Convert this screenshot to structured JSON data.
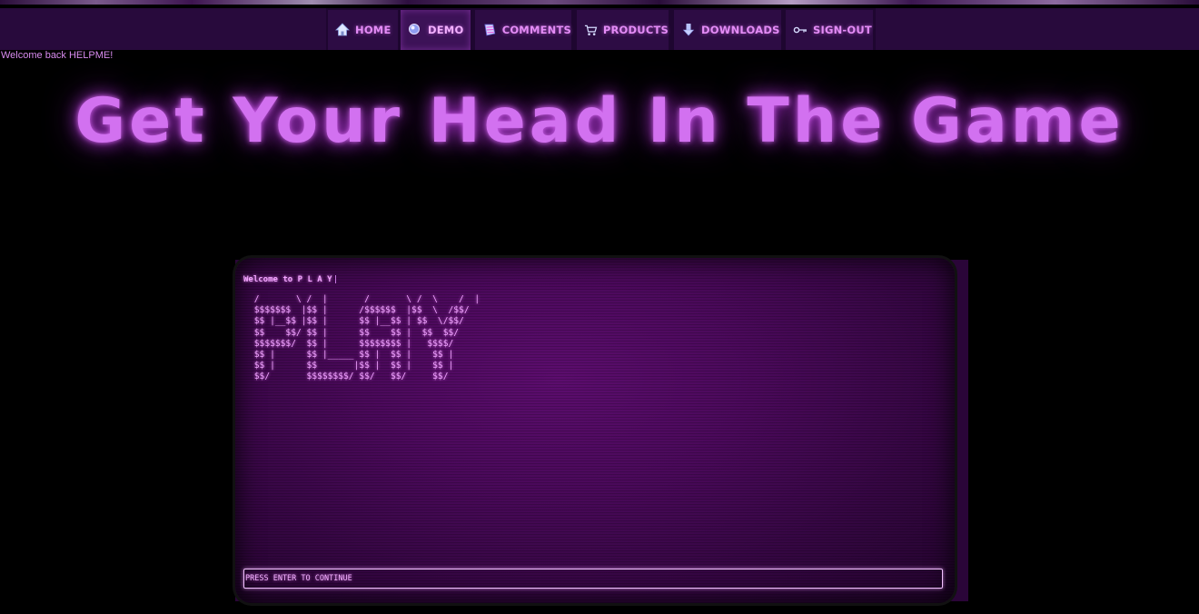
{
  "nav": {
    "items": [
      {
        "label": "HOME",
        "icon": "home-icon"
      },
      {
        "label": "DEMO",
        "icon": "demo-icon"
      },
      {
        "label": "COMMENTS",
        "icon": "comments-icon"
      },
      {
        "label": "PRODUCTS",
        "icon": "cart-icon"
      },
      {
        "label": "DOWNLOADS",
        "icon": "download-icon"
      },
      {
        "label": "SIGN-OUT",
        "icon": "key-icon"
      }
    ],
    "active": "DEMO"
  },
  "welcome": "Welcome back HELPME!",
  "headline": "Get Your Head In The Game",
  "terminal": {
    "title": "Welcome to P L A Y",
    "ascii_art": " /       \\ /  |       /       \\ /  \\    /  |\n $$$$$$$  |$$ |      /$$$$$$  |$$  \\  /$$/\n $$ |__$$ |$$ |      $$ |__$$ | $$  \\/$$/\n $$    $$/ $$ |      $$    $$ |  $$  $$/\n $$$$$$$/  $$ |      $$$$$$$$ |   $$$$/\n $$ |      $$ |_____ $$ |  $$ |    $$ |\n $$ |      $$       |$$ |  $$ |    $$ |\n $$/       $$$$$$$$/ $$/   $$/     $$/",
    "prompt": "PRESS ENTER TO CONTINUE"
  },
  "colors": {
    "accent": "#d271f0",
    "nav_bg": "#280a3c",
    "terminal_bg": "#4a095a"
  }
}
